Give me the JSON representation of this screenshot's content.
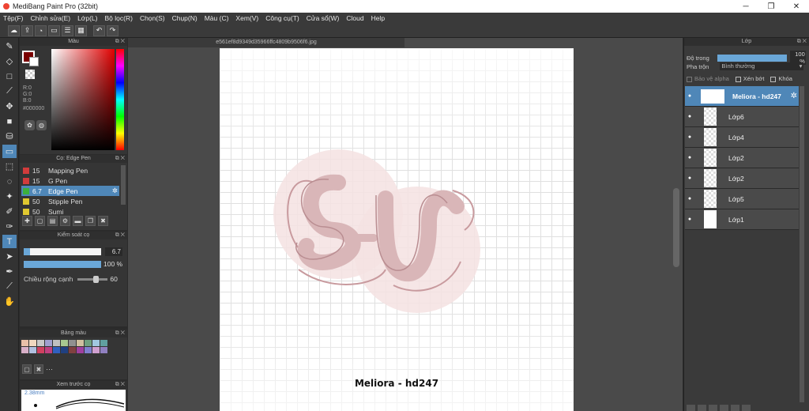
{
  "window": {
    "title": "MediBang Paint Pro (32bit)",
    "minimize": "─",
    "maximize": "❐",
    "close": "✕"
  },
  "menu": [
    "Tệp(F)",
    "Chỉnh sửa(E)",
    "Lớp(L)",
    "Bộ lọc(R)",
    "Chọn(S)",
    "Chụp(N)",
    "Màu (C)",
    "Xem(V)",
    "Công cụ(T)",
    "Cửa sổ(W)",
    "Cloud",
    "Help"
  ],
  "toolbar_icons": [
    "cloud-icon",
    "export-icon",
    "comment-icon",
    "chat-icon",
    "list-icon",
    "grid-icon",
    "undo-icon",
    "redo-icon"
  ],
  "tools": [
    "brush-icon",
    "eraser-icon",
    "rectangle-icon",
    "line-icon",
    "move-icon",
    "fill-rect-icon",
    "bucket-icon",
    "gradient-icon",
    "select-rect-icon",
    "lasso-icon",
    "magic-wand-icon",
    "select-pen-icon",
    "select-eraser-icon",
    "text-icon",
    "operation-icon",
    "eyedropper-icon",
    "divide-icon",
    "hand-icon"
  ],
  "color_panel": {
    "title": "Màu",
    "r": "R:0",
    "g": "G:0",
    "b": "B:0",
    "hex": "#000000"
  },
  "brush_panel": {
    "title": "Cọ: Edge Pen",
    "items": [
      {
        "size": "15",
        "name": "Mapping Pen",
        "color": "#d23c3c"
      },
      {
        "size": "15",
        "name": "G Pen",
        "color": "#d23c3c"
      },
      {
        "size": "6.7",
        "name": "Edge Pen",
        "color": "#3cb03c"
      },
      {
        "size": "50",
        "name": "Stipple Pen",
        "color": "#e0c830"
      },
      {
        "size": "50",
        "name": "Sumi",
        "color": "#e0c830"
      }
    ]
  },
  "control_panel": {
    "title": "Kiểm soát cọ",
    "size_value": "6.7",
    "size_fraction": 0.08,
    "opacity_value": "100 %",
    "opacity_fraction": 1.0,
    "edge_label": "Chiều rộng cạnh",
    "edge_value": "60",
    "edge_fraction": 0.6
  },
  "palette_panel": {
    "title": "Bảng màu",
    "colors": [
      "#e8c0a8",
      "#f0d8c0",
      "#c8c8c8",
      "#a0a0d0",
      "#c0c0c0",
      "#a8c890",
      "#909090",
      "#d0c0a0",
      "#70a080",
      "#a0c8e0",
      "#60a0a0",
      "#d8b0c8",
      "#b0c0e0",
      "#d04060",
      "#c04080",
      "#3060c0",
      "#204080",
      "#804040",
      "#a040a0",
      "#8080d0",
      "#d0a0d0",
      "#9080c0"
    ],
    "more": "···"
  },
  "preview_panel": {
    "title": "Xem trước cọ",
    "size_label": "2.38mm"
  },
  "canvas": {
    "doc_tab": "e561ef8d9349d35966ffc4809b9506f6.jpg",
    "signature": "Meliora - hd247"
  },
  "layer_panel": {
    "title": "Lớp",
    "opacity_label": "Độ trong",
    "opacity_value": "100 %",
    "blend_label": "Pha trộn",
    "blend_value": "Bình thường",
    "protect_alpha": "Bảo vệ alpha",
    "clipping": "Xén bớt",
    "lock": "Khóa",
    "layers": [
      {
        "name": "Meliora - hd247",
        "selected": true
      },
      {
        "name": "Lớp6",
        "selected": false
      },
      {
        "name": "Lớp4",
        "selected": false
      },
      {
        "name": "Lớp2",
        "selected": false
      },
      {
        "name": "Lớp2",
        "selected": false
      },
      {
        "name": "Lớp5",
        "selected": false
      },
      {
        "name": "Lớp1",
        "selected": false
      }
    ]
  }
}
